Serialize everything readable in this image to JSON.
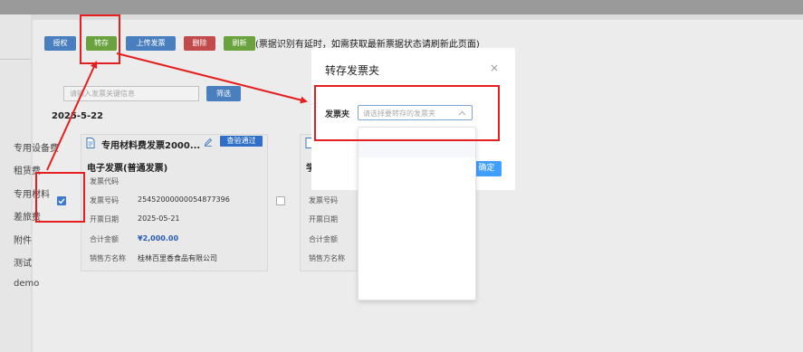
{
  "toolbar": {
    "authorize_label": "授权",
    "transfer_label": "转存",
    "upload_label": "上传发票",
    "delete_label": "删除",
    "refresh_label": "刷新",
    "hint": "(票据识别有延时，如需获取最新票据状态请刷新此页面)"
  },
  "filter": {
    "search_placeholder": "请输入发票关键信息",
    "filter_label": "筛选"
  },
  "date_group": "2025-5-22",
  "cards": [
    {
      "title": "专用材料费发票2000...",
      "status_badge": "查验通过",
      "type": "电子发票(普通发票)",
      "code_label": "发票代码",
      "code_value": "",
      "number_label": "发票号码",
      "number_value": "25452000000054877396",
      "date_label": "开票日期",
      "date_value": "2025-05-21",
      "amount_label": "合计金额",
      "amount_value": "¥2,000.00",
      "seller_label": "销售方名称",
      "seller_value": "桂林百里香食品有限公司",
      "checked": true
    },
    {
      "title": "",
      "type": "学",
      "code_label": "发票代码",
      "number_label": "发票号码",
      "date_label": "开票日期",
      "amount_label": "合计金额",
      "seller_label": "销售方名称",
      "checked": false
    }
  ],
  "modal": {
    "title": "转存发票夹",
    "close_glyph": "×",
    "folder_label": "发票夹",
    "select_placeholder": "请选择要转存的发票夹",
    "confirm_label": "确定"
  },
  "dropdown": {
    "options": [
      "专用设备费",
      "租赁费",
      "专用材料",
      "差旅费",
      "附件",
      "测试",
      "demo"
    ]
  },
  "colors": {
    "primary_blue": "#4a7fbf",
    "success_green": "#6aa33e",
    "danger_red": "#c24a4a",
    "annotation_red": "#e51f1f",
    "modal_confirm": "#409eff"
  }
}
